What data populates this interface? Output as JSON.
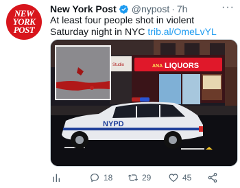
{
  "tweet": {
    "avatar_text": [
      "NEW",
      "YORK",
      "POST"
    ],
    "display_name": "New York Post",
    "handle": "@nypost",
    "separator": "·",
    "time": "7h",
    "text": "At least four people shot in violent Saturday night in NYC",
    "link": "trib.al/OmeLvYL",
    "more_icon": "more-horizontal-icon"
  },
  "media": {
    "store_sign": "LIQUORS",
    "store_sign_prefix": "ANA",
    "store_left_sign": "Studio",
    "car_label": "NYPD"
  },
  "actions": {
    "views_icon": "analytics-icon",
    "replies": "18",
    "retweets": "29",
    "likes": "45",
    "share_icon": "share-icon"
  },
  "colors": {
    "avatar_bg": "#d8151c",
    "link": "#1d9bf0",
    "muted": "#536471",
    "verified": "#1d9bf0"
  }
}
